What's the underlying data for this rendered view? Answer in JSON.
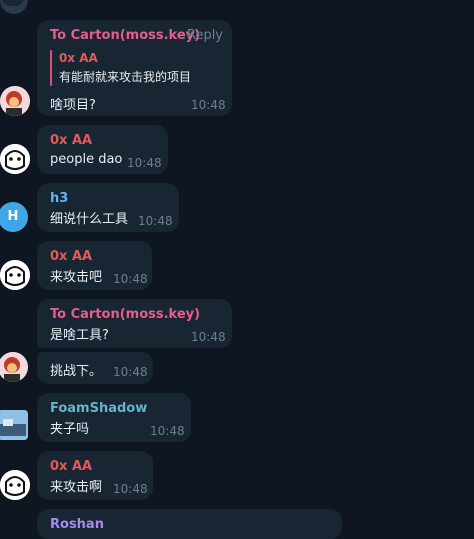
{
  "messages": [
    {
      "sender": "To Carton(moss.key)",
      "reply_label": "Reply",
      "quote_sender": "0x AA",
      "quote_text": "有能耐就来攻击我的项目",
      "text": "啥项目?",
      "time": "10:48"
    },
    {
      "sender": "0x AA",
      "text": "people dao",
      "time": "10:48"
    },
    {
      "sender": "h3",
      "text": "细说什么工具",
      "time": "10:48",
      "avatar_letter": "H"
    },
    {
      "sender": "0x AA",
      "text": "来攻击吧",
      "time": "10:48"
    },
    {
      "sender": "To Carton(moss.key)",
      "text": "是啥工具?",
      "time": "10:48"
    },
    {
      "text": "挑战下。",
      "time": "10:48"
    },
    {
      "sender": "FoamShadow",
      "text": "夹子吗",
      "time": "10:48"
    },
    {
      "sender": "0x AA",
      "text": "来攻击啊",
      "time": "10:48"
    },
    {
      "sender": "Roshan"
    }
  ],
  "colors": {
    "background": "#0e1621",
    "bubble": "#182533",
    "pink_name": "#e75d8c",
    "red_name": "#e25a5a",
    "blue_name": "#5eb5f7",
    "teal_name": "#63b5c9",
    "purple_name": "#a58bf0",
    "time": "#6d7f8f",
    "h3_avatar": "#3fa7e6"
  }
}
